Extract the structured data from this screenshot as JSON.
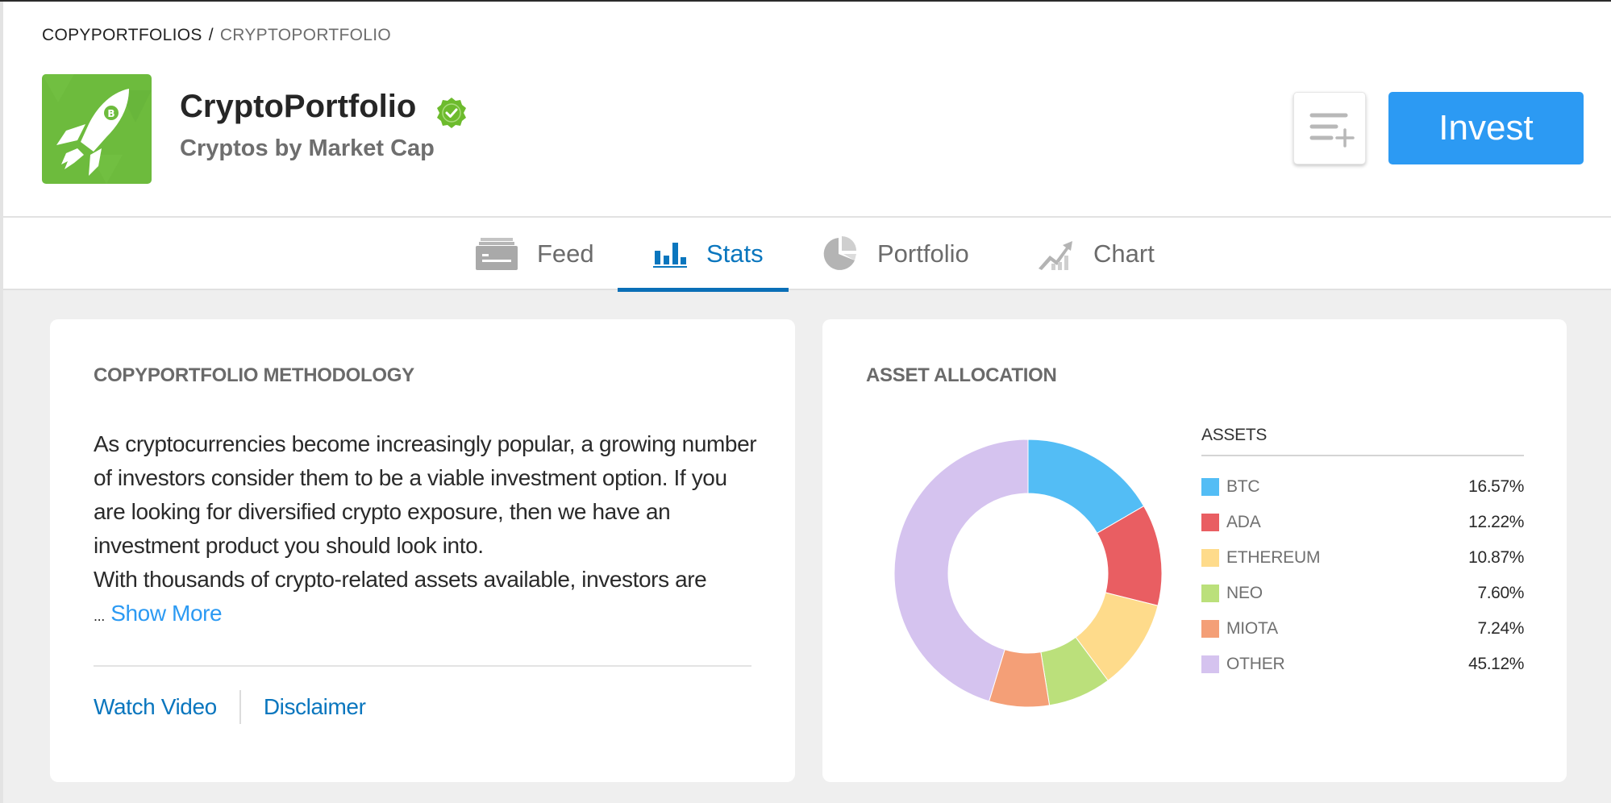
{
  "breadcrumb": {
    "root": "COPYPORTFOLIOS",
    "separator": "/",
    "current": "CRYPTOPORTFOLIO"
  },
  "header": {
    "title": "CryptoPortfolio",
    "subtitle": "Cryptos by Market Cap",
    "logo_icon": "rocket-bitcoin-icon",
    "verified_icon": "verified-badge-icon",
    "watchlist_icon": "add-to-watchlist-icon",
    "invest_label": "Invest"
  },
  "tabs": [
    {
      "label": "Feed",
      "icon": "feed-icon",
      "active": false
    },
    {
      "label": "Stats",
      "icon": "stats-icon",
      "active": true
    },
    {
      "label": "Portfolio",
      "icon": "portfolio-pie-icon",
      "active": false
    },
    {
      "label": "Chart",
      "icon": "chart-trend-icon",
      "active": false
    }
  ],
  "methodology": {
    "title": "COPYPORTFOLIO METHODOLOGY",
    "text_p1": "As cryptocurrencies become increasingly popular, a growing number of investors consider them to be a viable investment option. If you are looking for diversified crypto exposure, then we have an investment product you should look into.",
    "text_p2": "With thousands of crypto-related assets available, investors are",
    "ellipsis": "...",
    "show_more": "Show More",
    "links": {
      "watch_video": "Watch Video",
      "disclaimer": "Disclaimer"
    }
  },
  "allocation": {
    "title": "ASSET ALLOCATION",
    "legend_header": "ASSETS"
  },
  "chart_data": {
    "type": "pie",
    "variant": "donut",
    "title": "ASSET ALLOCATION",
    "legend_title": "ASSETS",
    "legend_position": "right",
    "categories": [
      "BTC",
      "ADA",
      "ETHEREUM",
      "NEO",
      "MIOTA",
      "OTHER"
    ],
    "values": [
      16.57,
      12.22,
      10.87,
      7.6,
      7.24,
      45.12
    ],
    "labels": [
      "16.57%",
      "12.22%",
      "10.87%",
      "7.60%",
      "7.24%",
      "45.12%"
    ],
    "colors": [
      "#53bdf5",
      "#e95e62",
      "#fedb8b",
      "#bbe07b",
      "#f49f77",
      "#d5c3ef"
    ],
    "start": "top-clockwise"
  }
}
